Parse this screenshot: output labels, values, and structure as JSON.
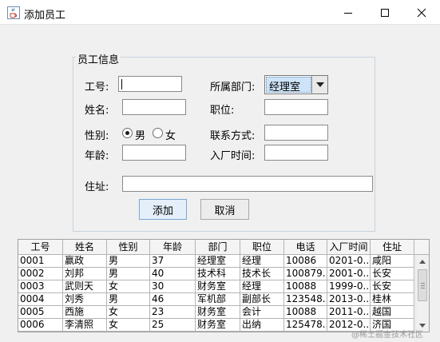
{
  "window": {
    "title": "添加员工",
    "icon": "java-coffee-cup-icon"
  },
  "form": {
    "group_title": "员工信息",
    "employee_id_label": "工号:",
    "employee_id_value": "",
    "name_label": "姓名:",
    "name_value": "",
    "gender_label": "性别:",
    "gender_options": [
      "男",
      "女"
    ],
    "gender_selected": "男",
    "age_label": "年龄:",
    "age_value": "",
    "department_label": "所属部门:",
    "department_value": "经理室",
    "position_label": "职位:",
    "position_value": "",
    "phone_label": "联系方式:",
    "phone_value": "",
    "hire_date_label": "入厂时间:",
    "hire_date_value": "",
    "address_label": "住址:",
    "address_value": ""
  },
  "buttons": {
    "add_label": "添加",
    "cancel_label": "取消"
  },
  "table": {
    "columns": [
      "工号",
      "姓名",
      "性别",
      "年龄",
      "部门",
      "职位",
      "电话",
      "入厂时间",
      "住址"
    ],
    "rows": [
      [
        "0001",
        "赢政",
        "男",
        "37",
        "经理室",
        "经理",
        "10086",
        "0201-0...",
        "咸阳"
      ],
      [
        "0002",
        "刘邦",
        "男",
        "40",
        "技术科",
        "技术长",
        "100879...",
        "2001-0...",
        "长安"
      ],
      [
        "0003",
        "武则天",
        "女",
        "30",
        "财务室",
        "经理",
        "10088",
        "1999-0...",
        "长安"
      ],
      [
        "0004",
        "刘秀",
        "男",
        "46",
        "军机部",
        "副部长",
        "123548...",
        "2013-0...",
        "桂林"
      ],
      [
        "0005",
        "西施",
        "女",
        "23",
        "财务室",
        "会计",
        "10088",
        "2011-0...",
        "越国"
      ],
      [
        "0006",
        "李清照",
        "女",
        "25",
        "财务室",
        "出纳",
        "125478...",
        "2012-0...",
        "济国"
      ]
    ]
  },
  "watermark": "@稀土掘金技术社区"
}
